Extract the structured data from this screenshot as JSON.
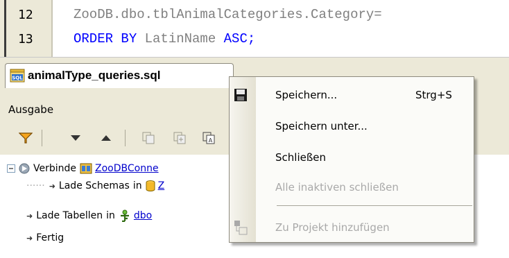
{
  "editor": {
    "lines": [
      {
        "num": "12",
        "code": "ZooDB.dbo.tblAnimalCategories.Category="
      },
      {
        "num": "13",
        "kw1": "ORDER BY",
        "mid": " LatinName ",
        "kw2": "ASC;"
      }
    ]
  },
  "tab": {
    "label": "animalType_queries.sql",
    "icon": "sql-file-icon"
  },
  "output": {
    "title": "Ausgabe",
    "toolbar": [
      {
        "icon": "filter-icon"
      },
      {
        "icon": "arrow-down-icon"
      },
      {
        "icon": "arrow-up-icon"
      },
      {
        "icon": "copy-icon"
      },
      {
        "icon": "copy-add-icon"
      },
      {
        "icon": "copy-text-icon"
      }
    ],
    "tree": [
      {
        "prefix": "Verbinde",
        "link": "ZooDBConne"
      },
      {
        "prefix": "Lade Schemas",
        "mid": "in",
        "link": "Z"
      },
      {
        "prefix": "Lade Tabellen",
        "mid": "in",
        "link": "dbo"
      },
      {
        "prefix": "Fertig"
      }
    ]
  },
  "context_menu": {
    "items": [
      {
        "label": "Speichern...",
        "shortcut": "Strg+S",
        "icon": "save-icon",
        "enabled": true
      },
      {
        "label": "Speichern unter...",
        "enabled": true
      },
      {
        "label": "Schließen",
        "enabled": true
      },
      {
        "label": "Alle inaktiven schließen",
        "enabled": false
      },
      {
        "label": "Zu Projekt hinzufügen",
        "icon": "add-to-project-icon",
        "enabled": false
      }
    ]
  },
  "colors": {
    "keyword": "#0000ff",
    "link": "#0000cc",
    "disabled": "#a9a9a9"
  }
}
